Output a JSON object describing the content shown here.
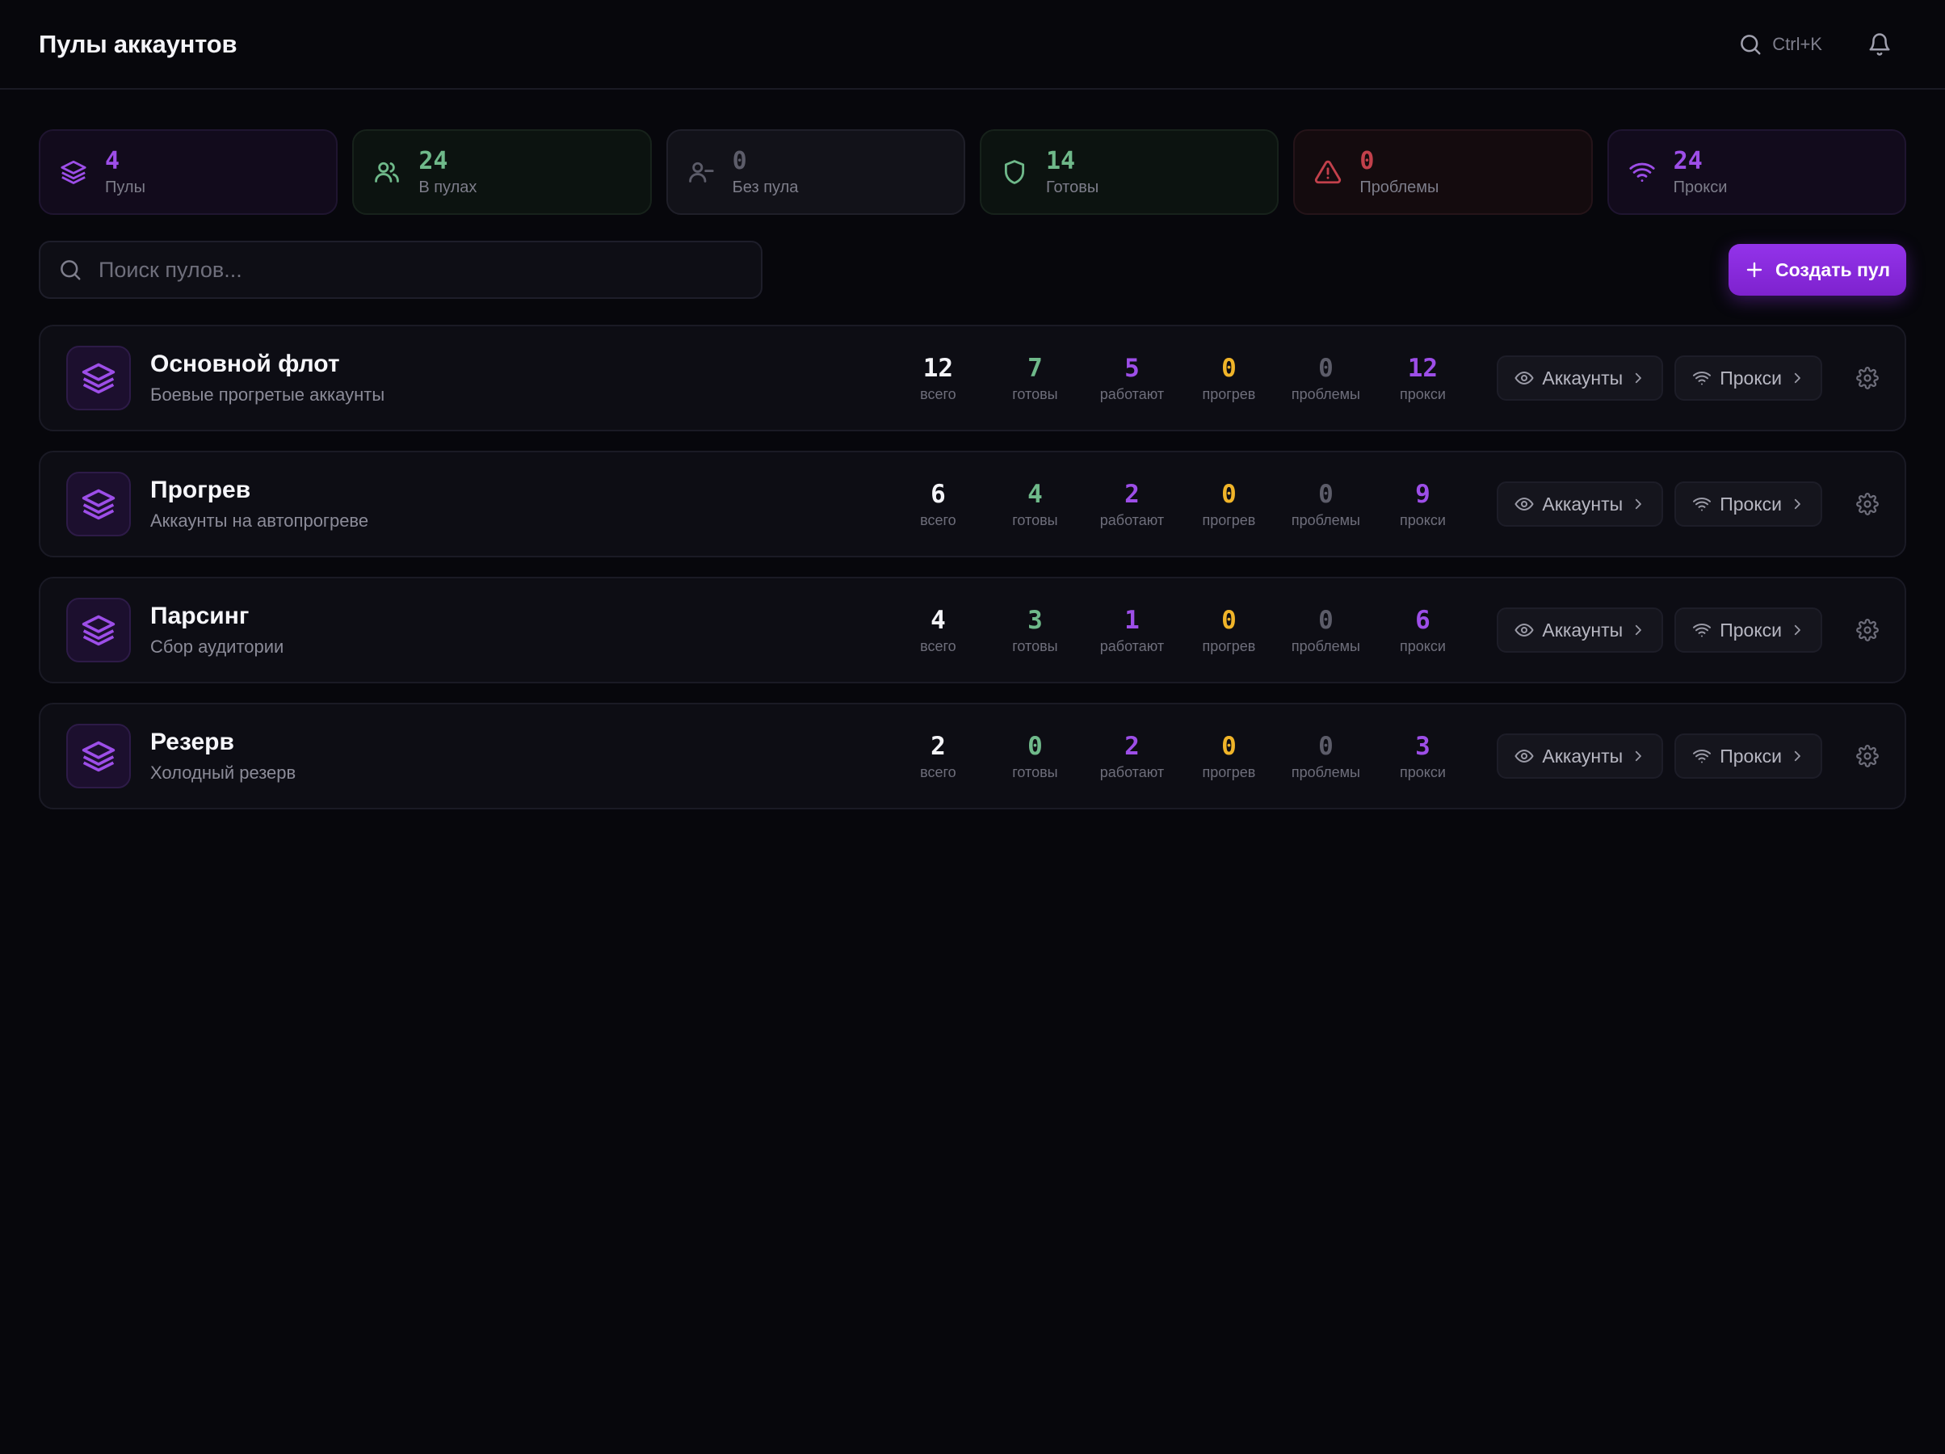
{
  "header": {
    "title": "Пулы аккаунтов",
    "search_shortcut": "Ctrl+K"
  },
  "colors": {
    "accent": "#9333ea",
    "green": "#6fb98a",
    "amber": "#f0b429",
    "red": "#c2404b",
    "gray": "#5c5c69",
    "background": "#07070c"
  },
  "stats": [
    {
      "value": "4",
      "label": "Пулы",
      "icon": "layers-icon",
      "color": "#9d4ee8",
      "bg": "#120b1c",
      "border": "#1f1530"
    },
    {
      "value": "24",
      "label": "В пулах",
      "icon": "users-icon",
      "color": "#6fb98a",
      "bg": "#0c1310",
      "border": "#17221b"
    },
    {
      "value": "0",
      "label": "Без пула",
      "icon": "user-minus-icon",
      "color": "#5c5c69",
      "bg": "#121219",
      "border": "#1f1f29"
    },
    {
      "value": "14",
      "label": "Готовы",
      "icon": "shield-icon",
      "color": "#6fb98a",
      "bg": "#0c1310",
      "border": "#17221b"
    },
    {
      "value": "0",
      "label": "Проблемы",
      "icon": "alert-triangle-icon",
      "color": "#c2404b",
      "bg": "#140b0e",
      "border": "#251419"
    },
    {
      "value": "24",
      "label": "Прокси",
      "icon": "wifi-icon",
      "color": "#9d4ee8",
      "bg": "#120b1c",
      "border": "#1f1530"
    }
  ],
  "search": {
    "placeholder": "Поиск пулов..."
  },
  "create_button": {
    "label": "Создать пул"
  },
  "metric_labels": [
    "всего",
    "готовы",
    "работают",
    "прогрев",
    "проблемы",
    "прокси"
  ],
  "metric_colors": [
    "c-white",
    "c-green",
    "c-purple",
    "c-amber",
    "c-gray",
    "c-purple"
  ],
  "pool_actions": {
    "accounts": "Аккаунты",
    "proxies": "Прокси"
  },
  "pools": [
    {
      "name": "Основной флот",
      "description": "Боевые прогретые аккаунты",
      "metrics": [
        "12",
        "7",
        "5",
        "0",
        "0",
        "12"
      ]
    },
    {
      "name": "Прогрев",
      "description": "Аккаунты на автопрогреве",
      "metrics": [
        "6",
        "4",
        "2",
        "0",
        "0",
        "9"
      ]
    },
    {
      "name": "Парсинг",
      "description": "Сбор аудитории",
      "metrics": [
        "4",
        "3",
        "1",
        "0",
        "0",
        "6"
      ]
    },
    {
      "name": "Резерв",
      "description": "Холодный резерв",
      "metrics": [
        "2",
        "0",
        "2",
        "0",
        "0",
        "3"
      ]
    }
  ]
}
